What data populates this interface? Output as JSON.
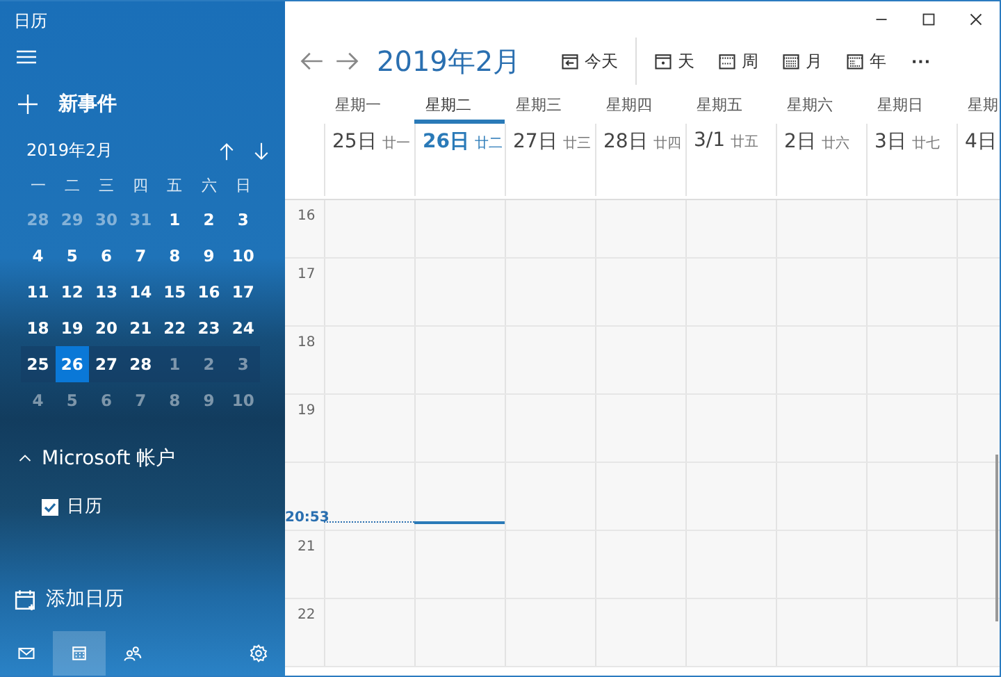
{
  "window": {
    "title": "日历"
  },
  "sidebar": {
    "new_event": "新事件",
    "mini_calendar": {
      "month": "2019年2月",
      "weekdays": [
        "一",
        "二",
        "三",
        "四",
        "五",
        "六",
        "日"
      ],
      "weeks": [
        {
          "current": false,
          "days": [
            {
              "text": "28",
              "other_month": true,
              "selected": false
            },
            {
              "text": "29",
              "other_month": true,
              "selected": false
            },
            {
              "text": "30",
              "other_month": true,
              "selected": false
            },
            {
              "text": "31",
              "other_month": true,
              "selected": false
            },
            {
              "text": "1",
              "other_month": false,
              "selected": false
            },
            {
              "text": "2",
              "other_month": false,
              "selected": false
            },
            {
              "text": "3",
              "other_month": false,
              "selected": false
            }
          ]
        },
        {
          "current": false,
          "days": [
            {
              "text": "4",
              "other_month": false,
              "selected": false
            },
            {
              "text": "5",
              "other_month": false,
              "selected": false
            },
            {
              "text": "6",
              "other_month": false,
              "selected": false
            },
            {
              "text": "7",
              "other_month": false,
              "selected": false
            },
            {
              "text": "8",
              "other_month": false,
              "selected": false
            },
            {
              "text": "9",
              "other_month": false,
              "selected": false
            },
            {
              "text": "10",
              "other_month": false,
              "selected": false
            }
          ]
        },
        {
          "current": false,
          "days": [
            {
              "text": "11",
              "other_month": false,
              "selected": false
            },
            {
              "text": "12",
              "other_month": false,
              "selected": false
            },
            {
              "text": "13",
              "other_month": false,
              "selected": false
            },
            {
              "text": "14",
              "other_month": false,
              "selected": false
            },
            {
              "text": "15",
              "other_month": false,
              "selected": false
            },
            {
              "text": "16",
              "other_month": false,
              "selected": false
            },
            {
              "text": "17",
              "other_month": false,
              "selected": false
            }
          ]
        },
        {
          "current": false,
          "days": [
            {
              "text": "18",
              "other_month": false,
              "selected": false
            },
            {
              "text": "19",
              "other_month": false,
              "selected": false
            },
            {
              "text": "20",
              "other_month": false,
              "selected": false
            },
            {
              "text": "21",
              "other_month": false,
              "selected": false
            },
            {
              "text": "22",
              "other_month": false,
              "selected": false
            },
            {
              "text": "23",
              "other_month": false,
              "selected": false
            },
            {
              "text": "24",
              "other_month": false,
              "selected": false
            }
          ]
        },
        {
          "current": true,
          "days": [
            {
              "text": "25",
              "other_month": false,
              "selected": false
            },
            {
              "text": "26",
              "other_month": false,
              "selected": true
            },
            {
              "text": "27",
              "other_month": false,
              "selected": false
            },
            {
              "text": "28",
              "other_month": false,
              "selected": false
            },
            {
              "text": "1",
              "other_month": true,
              "selected": false
            },
            {
              "text": "2",
              "other_month": true,
              "selected": false
            },
            {
              "text": "3",
              "other_month": true,
              "selected": false
            }
          ]
        },
        {
          "current": false,
          "days": [
            {
              "text": "4",
              "other_month": true,
              "selected": false
            },
            {
              "text": "5",
              "other_month": true,
              "selected": false
            },
            {
              "text": "6",
              "other_month": true,
              "selected": false
            },
            {
              "text": "7",
              "other_month": true,
              "selected": false
            },
            {
              "text": "8",
              "other_month": true,
              "selected": false
            },
            {
              "text": "9",
              "other_month": true,
              "selected": false
            },
            {
              "text": "10",
              "other_month": true,
              "selected": false
            }
          ]
        }
      ]
    },
    "account": {
      "name": "Microsoft 帐户",
      "expanded": true,
      "calendars": [
        {
          "label": "日历",
          "checked": true
        }
      ]
    },
    "add_calendar": "添加日历",
    "nav": [
      {
        "kind": "mail",
        "selected": false
      },
      {
        "kind": "calendar",
        "selected": true
      },
      {
        "kind": "people",
        "selected": false
      },
      {
        "kind": "settings",
        "selected": false
      }
    ]
  },
  "toolbar": {
    "title": "2019年2月",
    "today": "今天",
    "views": [
      {
        "kind": "day",
        "label": "天"
      },
      {
        "kind": "week",
        "label": "周"
      },
      {
        "kind": "month",
        "label": "月"
      },
      {
        "kind": "year",
        "label": "年"
      }
    ],
    "more": "···"
  },
  "days": [
    {
      "weekday": "星期一",
      "date": "25日",
      "lunar": "廿一",
      "selected": false
    },
    {
      "weekday": "星期二",
      "date": "26日",
      "lunar": "廿二",
      "selected": true
    },
    {
      "weekday": "星期三",
      "date": "27日",
      "lunar": "廿三",
      "selected": false
    },
    {
      "weekday": "星期四",
      "date": "28日",
      "lunar": "廿四",
      "selected": false
    },
    {
      "weekday": "星期五",
      "date": "3/1",
      "lunar": "廿五",
      "selected": false
    },
    {
      "weekday": "星期六",
      "date": "2日",
      "lunar": "廿六",
      "selected": false
    },
    {
      "weekday": "星期日",
      "date": "3日",
      "lunar": "廿七",
      "selected": false
    },
    {
      "weekday": "星期",
      "date": "4日",
      "selected": false
    }
  ],
  "hours": [
    {
      "kind": "hour",
      "label": "16"
    },
    {
      "kind": "hour",
      "label": "17"
    },
    {
      "kind": "hour",
      "label": "18"
    },
    {
      "kind": "hour",
      "label": "19"
    },
    {
      "kind": "now",
      "label": "20:53"
    },
    {
      "kind": "hour",
      "label": "21"
    },
    {
      "kind": "hour",
      "label": "22"
    }
  ]
}
